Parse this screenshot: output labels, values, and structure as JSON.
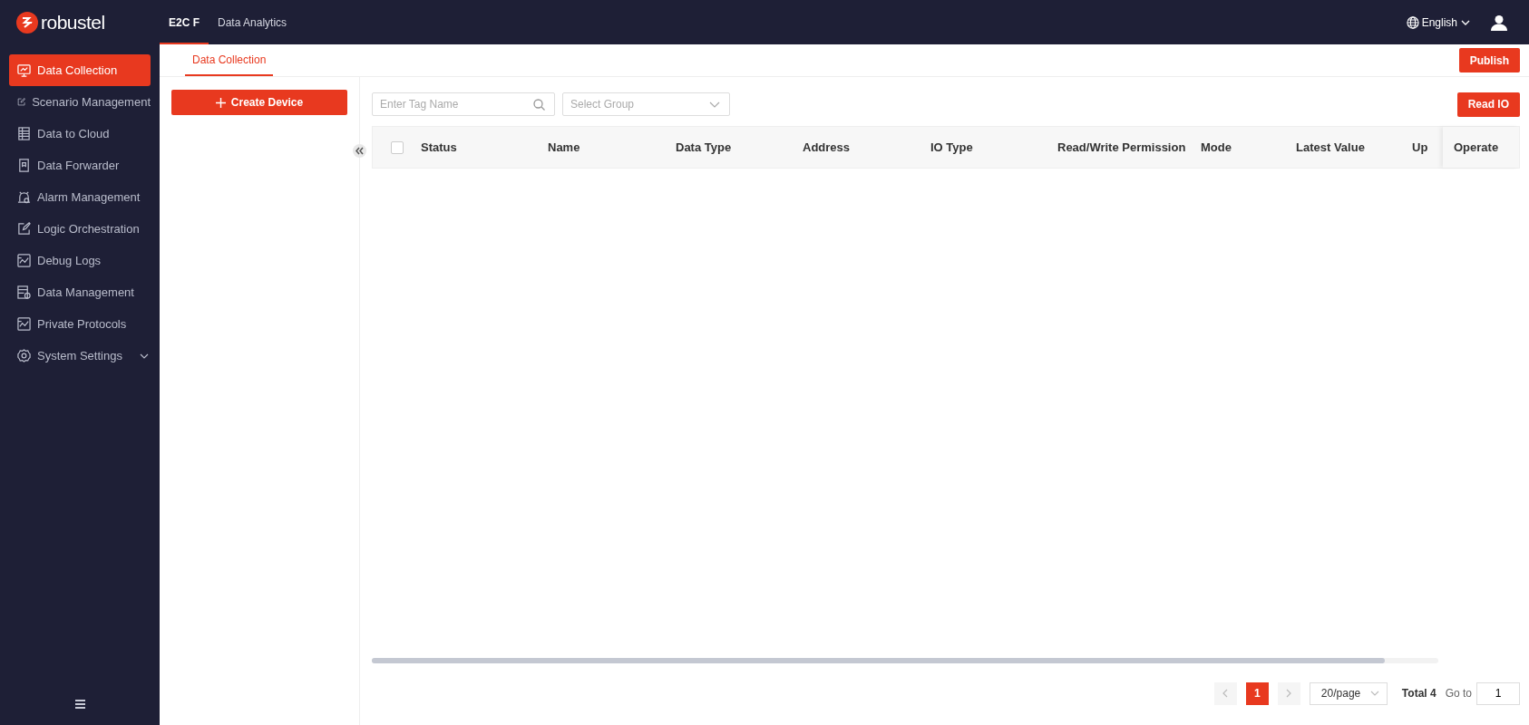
{
  "header": {
    "logo": "robustel",
    "nav": [
      {
        "label": "E2C F",
        "selected": true
      },
      {
        "label": "Data Analytics",
        "selected": false
      }
    ],
    "language": "English"
  },
  "sidebar": {
    "items": [
      {
        "label": "Data Collection",
        "selected": true,
        "expandable": false
      },
      {
        "label": "Scenario Management",
        "selected": false,
        "expandable": false
      },
      {
        "label": "Data to Cloud",
        "selected": false,
        "expandable": false
      },
      {
        "label": "Data Forwarder",
        "selected": false,
        "expandable": false
      },
      {
        "label": "Alarm Management",
        "selected": false,
        "expandable": false
      },
      {
        "label": "Logic Orchestration",
        "selected": false,
        "expandable": false
      },
      {
        "label": "Debug Logs",
        "selected": false,
        "expandable": false
      },
      {
        "label": "Data Management",
        "selected": false,
        "expandable": false
      },
      {
        "label": "Private Protocols",
        "selected": false,
        "expandable": false
      },
      {
        "label": "System Settings",
        "selected": false,
        "expandable": true
      }
    ]
  },
  "tabs": [
    {
      "label": "Data Collection",
      "selected": true
    }
  ],
  "publish_button": "Publish",
  "create_device_button": "Create Device",
  "search": {
    "placeholder": "Enter Tag Name"
  },
  "group_select": {
    "placeholder": "Select Group"
  },
  "read_io_button": "Read IO",
  "table": {
    "columns": [
      "Status",
      "Name",
      "Data Type",
      "Address",
      "IO Type",
      "Read/Write Permission",
      "Mode",
      "Latest Value",
      "Up"
    ],
    "fixed_column": "Operate",
    "select_all_checked": false
  },
  "pagination": {
    "pages": [
      {
        "label": "1",
        "selected": true
      }
    ],
    "page_size": "20/page",
    "total": "Total 4",
    "goto_label": "Go to",
    "goto_value": "1"
  }
}
